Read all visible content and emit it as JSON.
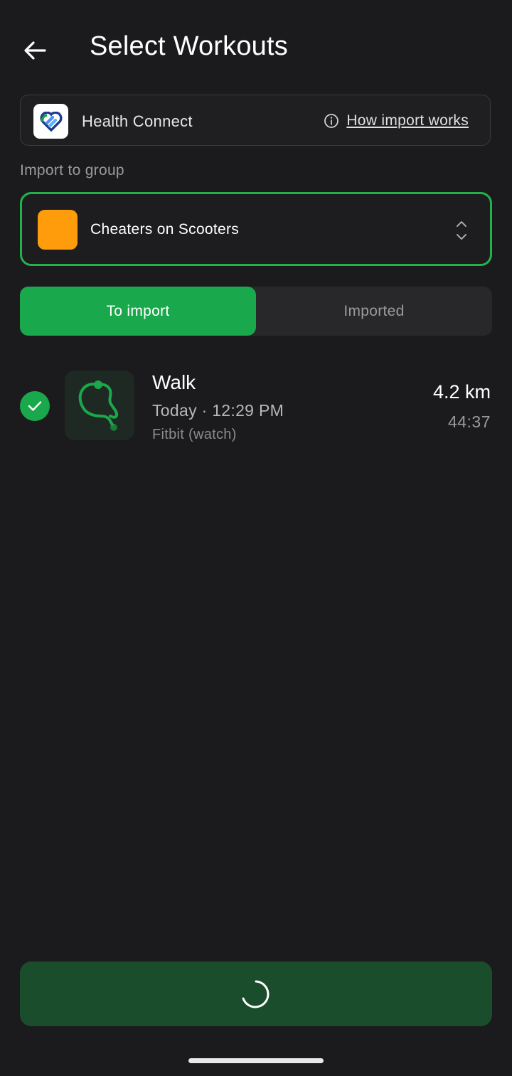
{
  "header": {
    "title": "Select Workouts",
    "back_icon": "arrow-left-icon"
  },
  "source": {
    "name": "Health Connect",
    "logo_icon": "health-connect-icon",
    "info_icon": "info-icon",
    "help_link": "How import works"
  },
  "group": {
    "label": "Import to group",
    "selected": "Cheaters on Scooters",
    "swatch_color": "#ff9c0c",
    "chevron_icon": "unfold-chevrons-icon"
  },
  "tabs": [
    {
      "label": "To import",
      "active": true
    },
    {
      "label": "Imported",
      "active": false
    }
  ],
  "workouts": [
    {
      "title": "Walk",
      "time": "Today · 12:29 PM",
      "source": "Fitbit (watch)",
      "distance": "4.2 km",
      "duration": "44:37",
      "selected": true
    }
  ],
  "footer": {
    "button_state": "loading",
    "spinner_icon": "loading-spinner-icon"
  },
  "colors": {
    "accent": "#19a84b",
    "background": "#1b1b1d",
    "button_loading": "#1a4d2c"
  }
}
